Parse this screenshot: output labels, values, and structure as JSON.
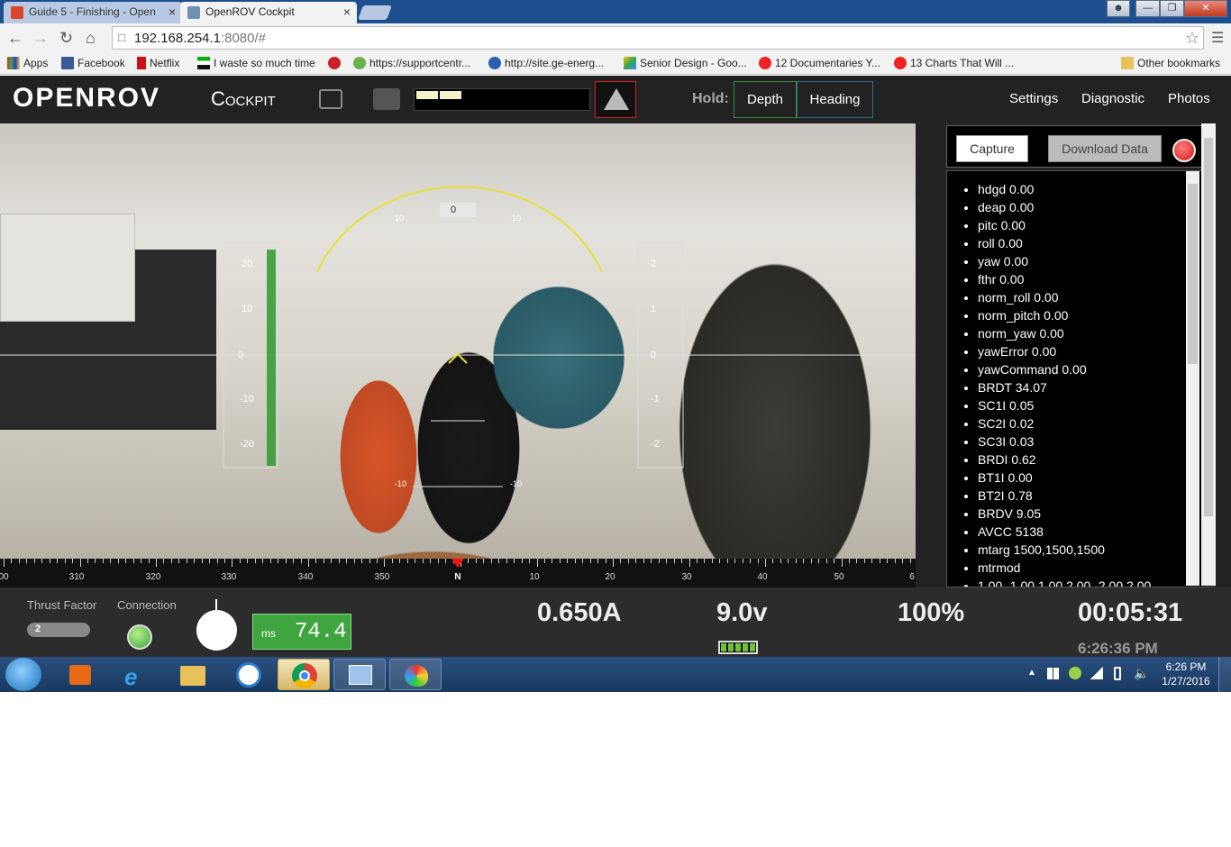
{
  "browser": {
    "tabs": [
      {
        "title": "Guide 5 - Finishing - Open"
      },
      {
        "title": "OpenROV Cockpit"
      }
    ],
    "url_host": "192.168.254.1",
    "url_rest": ":8080/#",
    "bookmarks": [
      {
        "label": "Apps"
      },
      {
        "label": "Facebook"
      },
      {
        "label": "Netflix"
      },
      {
        "label": "I waste so much time"
      },
      {
        "label": "https://supportcentr..."
      },
      {
        "label": "http://site.ge-energ..."
      },
      {
        "label": "Senior Design - Goo..."
      },
      {
        "label": "12 Documentaries Y..."
      },
      {
        "label": "13 Charts That Will ..."
      }
    ],
    "other_bookmarks": "Other bookmarks"
  },
  "cockpit": {
    "logo": "OPENROV",
    "title": "Cockpit",
    "hold_label": "Hold:",
    "hold_buttons": [
      "Depth",
      "Heading"
    ],
    "nav": [
      "Settings",
      "Diagnostic",
      "Photos"
    ]
  },
  "hud": {
    "heading_center": "0",
    "heading_left": "10",
    "heading_right": "10",
    "depth_scale": [
      "20",
      "10",
      "0",
      "-10",
      "-20"
    ],
    "pitch_scale": [
      "2",
      "1",
      "0",
      "-1",
      "-2"
    ],
    "pitch_low_left": "-10",
    "pitch_low_right": "-10"
  },
  "compass": {
    "labels": [
      "00",
      "310",
      "320",
      "330",
      "340",
      "350",
      "N",
      "10",
      "20",
      "30",
      "40",
      "50",
      "6"
    ]
  },
  "panel": {
    "capture": "Capture",
    "download": "Download Data",
    "telemetry": [
      "hdgd 0.00",
      "deap 0.00",
      "pitc 0.00",
      "roll 0.00",
      "yaw 0.00",
      "fthr 0.00",
      "norm_roll 0.00",
      "norm_pitch 0.00",
      "norm_yaw 0.00",
      "yawError 0.00",
      "yawCommand 0.00",
      "BRDT 34.07",
      "SC1I 0.05",
      "SC2I 0.02",
      "SC3I 0.03",
      "BRDI 0.62",
      "BT1I 0.00",
      "BT2I 0.78",
      "BRDV 9.05",
      "AVCC 5138",
      "mtarg 1500,1500,1500",
      "mtrmod",
      "1.00,-1.00,1.00,2.00,-2.00,2.00"
    ]
  },
  "status": {
    "thrust_label": "Thrust Factor",
    "thrust_value": "2",
    "connection_label": "Connection",
    "ms_label": "ms",
    "ms_value": "74.4",
    "current": "0.650A",
    "voltage": "9.0v",
    "percent": "100%",
    "elapsed": "00:05:31",
    "clock": "6:26:36 PM"
  },
  "taskbar": {
    "time": "6:26 PM",
    "date": "1/27/2016"
  },
  "colors": {
    "accent_green": "#3fa63f",
    "hud_yellow": "#e6e03a",
    "record_red": "#d01b1b",
    "header_bg": "#222222"
  }
}
